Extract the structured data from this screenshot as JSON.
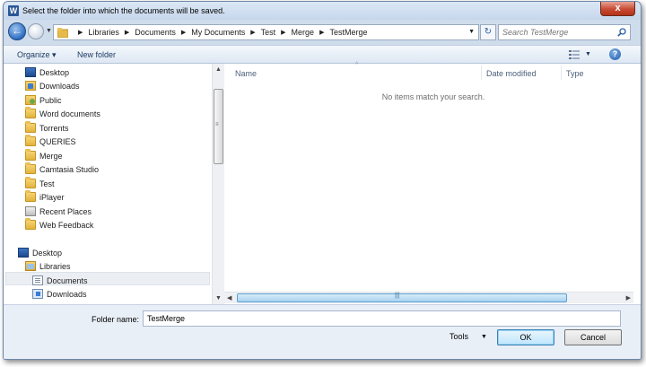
{
  "window": {
    "title": "Select the folder into which the documents will be saved.",
    "app_icon_letter": "W",
    "close_glyph": "x"
  },
  "address": {
    "crumbs": [
      "Libraries",
      "Documents",
      "My Documents",
      "Test",
      "Merge",
      "TestMerge"
    ],
    "search_placeholder": "Search TestMerge"
  },
  "toolbar": {
    "organize_label": "Organize ▾",
    "new_folder_label": "New folder",
    "help_glyph": "?"
  },
  "nav_pane": {
    "favorites": [
      {
        "label": "Desktop",
        "icon": "desktop-icon"
      },
      {
        "label": "Downloads",
        "icon": "downloads-folder-icon"
      },
      {
        "label": "Public",
        "icon": "public-folder-icon"
      },
      {
        "label": "Word documents",
        "icon": "folder-icon"
      },
      {
        "label": "Torrents",
        "icon": "folder-icon"
      },
      {
        "label": "QUERIES",
        "icon": "folder-icon"
      },
      {
        "label": "Merge",
        "icon": "folder-icon"
      },
      {
        "label": "Camtasia Studio",
        "icon": "folder-icon"
      },
      {
        "label": "Test",
        "icon": "folder-icon"
      },
      {
        "label": "iPlayer",
        "icon": "folder-icon"
      },
      {
        "label": "Recent Places",
        "icon": "recent-places-icon"
      },
      {
        "label": "Web Feedback",
        "icon": "folder-icon"
      }
    ],
    "tree": [
      {
        "label": "Desktop",
        "icon": "desktop-icon",
        "level": 0
      },
      {
        "label": "Libraries",
        "icon": "libraries-icon",
        "level": 1
      },
      {
        "label": "Documents",
        "icon": "documents-library-icon",
        "level": 2,
        "selected": true
      },
      {
        "label": "Downloads",
        "icon": "downloads-library-icon",
        "level": 2
      }
    ]
  },
  "file_list": {
    "columns": [
      "Name",
      "Date modified",
      "Type"
    ],
    "empty_message": "No items match your search."
  },
  "footer": {
    "folder_name_label": "Folder name:",
    "folder_name_value": "TestMerge",
    "tools_label": "Tools",
    "ok_label": "OK",
    "cancel_label": "Cancel"
  }
}
